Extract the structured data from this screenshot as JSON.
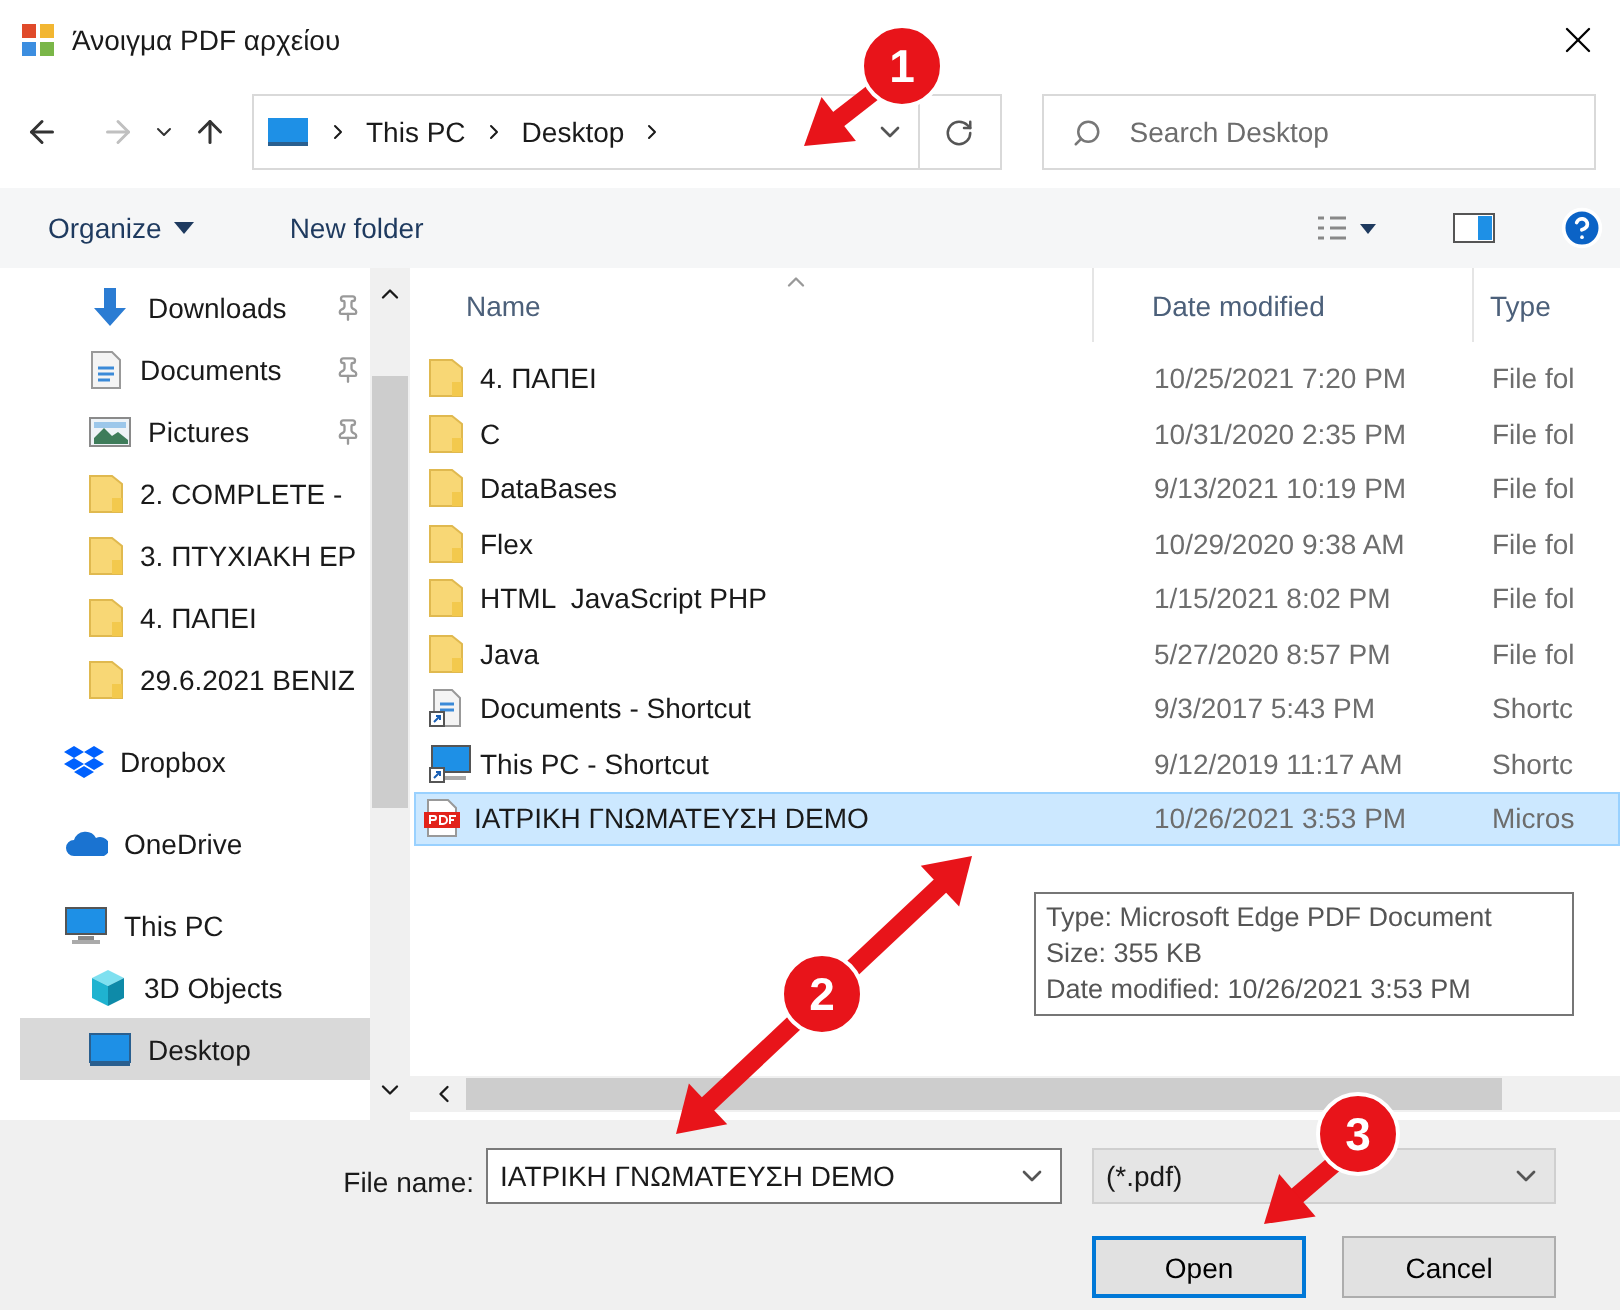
{
  "window": {
    "title": "Άνοιγμα PDF αρχείου"
  },
  "address": {
    "crumbs": [
      "This PC",
      "Desktop"
    ]
  },
  "search": {
    "placeholder": "Search Desktop"
  },
  "toolbar": {
    "organize": "Organize",
    "new_folder": "New folder"
  },
  "sidebar": {
    "quick_access": [
      {
        "label": "Downloads",
        "kind": "downloads",
        "pinned": true,
        "selected": false
      },
      {
        "label": "Documents",
        "kind": "documents",
        "pinned": true,
        "selected": false
      },
      {
        "label": "Pictures",
        "kind": "pictures",
        "pinned": true,
        "selected": false
      },
      {
        "label": "2. COMPLETE -",
        "kind": "folder",
        "pinned": false,
        "selected": false
      },
      {
        "label": "3. ΠΤΥΧΙΑΚΗ ΕΡ",
        "kind": "folder",
        "pinned": false,
        "selected": false
      },
      {
        "label": "4. ΠΑΠΕΙ",
        "kind": "folder",
        "pinned": false,
        "selected": false
      },
      {
        "label": "29.6.2021 ΒΕΝΙΖ",
        "kind": "folder",
        "pinned": false,
        "selected": false
      }
    ],
    "roots": [
      {
        "label": "Dropbox",
        "kind": "dropbox",
        "selected": false
      },
      {
        "label": "OneDrive",
        "kind": "onedrive",
        "selected": false
      },
      {
        "label": "This PC",
        "kind": "pc",
        "selected": false,
        "children": [
          {
            "label": "3D Objects",
            "kind": "objects",
            "selected": false
          },
          {
            "label": "Desktop",
            "kind": "desktop",
            "selected": true
          }
        ]
      }
    ]
  },
  "table": {
    "columns": [
      "Name",
      "Date modified",
      "Type"
    ],
    "rows": [
      {
        "name": "4. ΠΑΠΕΙ",
        "date": "10/25/2021 7:20 PM",
        "type": "File fol",
        "kind": "folder",
        "selected": false
      },
      {
        "name": "C",
        "date": "10/31/2020 2:35 PM",
        "type": "File fol",
        "kind": "folder",
        "selected": false
      },
      {
        "name": "DataBases",
        "date": "9/13/2021 10:19 PM",
        "type": "File fol",
        "kind": "folder",
        "selected": false
      },
      {
        "name": "Flex",
        "date": "10/29/2020 9:38 AM",
        "type": "File fol",
        "kind": "folder",
        "selected": false
      },
      {
        "name": "HTML  JavaScript PHP",
        "date": "1/15/2021 8:02 PM",
        "type": "File fol",
        "kind": "folder",
        "selected": false
      },
      {
        "name": "Java",
        "date": "5/27/2020 8:57 PM",
        "type": "File fol",
        "kind": "folder",
        "selected": false
      },
      {
        "name": "Documents - Shortcut",
        "date": "9/3/2017 5:43 PM",
        "type": "Shortc",
        "kind": "doc-shortcut",
        "selected": false
      },
      {
        "name": "This PC - Shortcut",
        "date": "9/12/2019 11:17 AM",
        "type": "Shortc",
        "kind": "pc-shortcut",
        "selected": false
      },
      {
        "name": "ΙΑΤΡΙΚΗ ΓΝΩΜΑΤΕΥΣΗ DEMO",
        "date": "10/26/2021 3:53 PM",
        "type": "Micros",
        "kind": "pdf",
        "selected": true
      }
    ]
  },
  "tooltip": {
    "lines": [
      "Type: Microsoft Edge PDF Document",
      "Size: 355 KB",
      "Date modified: 10/26/2021 3:53 PM"
    ]
  },
  "file_name": {
    "label": "File name:",
    "value": "ΙΑΤΡΙΚΗ ΓΝΩΜΑΤΕΥΣΗ DEMO"
  },
  "filter": {
    "value": "(*.pdf)"
  },
  "buttons": [
    {
      "label": "Open",
      "default": true
    },
    {
      "label": "Cancel",
      "default": false
    }
  ],
  "annotations": [
    {
      "label": "1"
    },
    {
      "label": "2"
    },
    {
      "label": "3"
    }
  ]
}
